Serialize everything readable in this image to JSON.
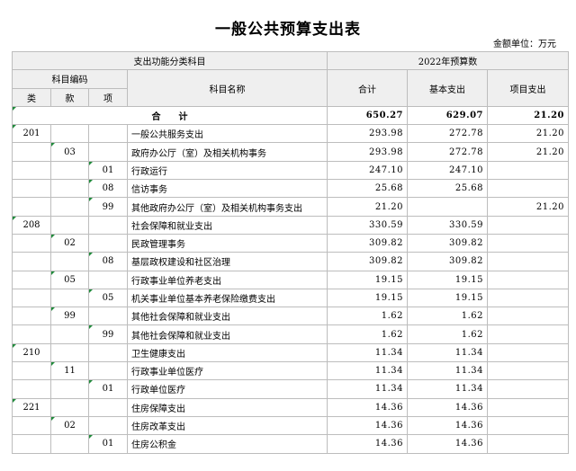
{
  "title": "一般公共预算支出表",
  "unit_label": "金额单位：万元",
  "header": {
    "func_class": "支出功能分类科目",
    "budget_year": "2022年预算数",
    "subject_code": "科目编码",
    "lei": "类",
    "kuan": "款",
    "xiang": "项",
    "subject_name": "科目名称",
    "total": "合计",
    "basic": "基本支出",
    "project": "项目支出"
  },
  "total_row": {
    "label": "合　　计",
    "total": "650.27",
    "basic": "629.07",
    "project": "21.20"
  },
  "rows": [
    {
      "lei": "201",
      "kuan": "",
      "xiang": "",
      "name": "一般公共服务支出",
      "total": "293.98",
      "basic": "272.78",
      "project": "21.20"
    },
    {
      "lei": "",
      "kuan": "03",
      "xiang": "",
      "name": "政府办公厅（室）及相关机构事务",
      "total": "293.98",
      "basic": "272.78",
      "project": "21.20"
    },
    {
      "lei": "",
      "kuan": "",
      "xiang": "01",
      "name": "行政运行",
      "total": "247.10",
      "basic": "247.10",
      "project": ""
    },
    {
      "lei": "",
      "kuan": "",
      "xiang": "08",
      "name": "信访事务",
      "total": "25.68",
      "basic": "25.68",
      "project": ""
    },
    {
      "lei": "",
      "kuan": "",
      "xiang": "99",
      "name": "其他政府办公厅（室）及相关机构事务支出",
      "total": "21.20",
      "basic": "",
      "project": "21.20"
    },
    {
      "lei": "208",
      "kuan": "",
      "xiang": "",
      "name": "社会保障和就业支出",
      "total": "330.59",
      "basic": "330.59",
      "project": ""
    },
    {
      "lei": "",
      "kuan": "02",
      "xiang": "",
      "name": "民政管理事务",
      "total": "309.82",
      "basic": "309.82",
      "project": ""
    },
    {
      "lei": "",
      "kuan": "",
      "xiang": "08",
      "name": "基层政权建设和社区治理",
      "total": "309.82",
      "basic": "309.82",
      "project": ""
    },
    {
      "lei": "",
      "kuan": "05",
      "xiang": "",
      "name": "行政事业单位养老支出",
      "total": "19.15",
      "basic": "19.15",
      "project": ""
    },
    {
      "lei": "",
      "kuan": "",
      "xiang": "05",
      "name": "机关事业单位基本养老保险缴费支出",
      "total": "19.15",
      "basic": "19.15",
      "project": ""
    },
    {
      "lei": "",
      "kuan": "99",
      "xiang": "",
      "name": "其他社会保障和就业支出",
      "total": "1.62",
      "basic": "1.62",
      "project": ""
    },
    {
      "lei": "",
      "kuan": "",
      "xiang": "99",
      "name": "其他社会保障和就业支出",
      "total": "1.62",
      "basic": "1.62",
      "project": ""
    },
    {
      "lei": "210",
      "kuan": "",
      "xiang": "",
      "name": "卫生健康支出",
      "total": "11.34",
      "basic": "11.34",
      "project": ""
    },
    {
      "lei": "",
      "kuan": "11",
      "xiang": "",
      "name": "行政事业单位医疗",
      "total": "11.34",
      "basic": "11.34",
      "project": ""
    },
    {
      "lei": "",
      "kuan": "",
      "xiang": "01",
      "name": "行政单位医疗",
      "total": "11.34",
      "basic": "11.34",
      "project": ""
    },
    {
      "lei": "221",
      "kuan": "",
      "xiang": "",
      "name": "住房保障支出",
      "total": "14.36",
      "basic": "14.36",
      "project": ""
    },
    {
      "lei": "",
      "kuan": "02",
      "xiang": "",
      "name": "住房改革支出",
      "total": "14.36",
      "basic": "14.36",
      "project": ""
    },
    {
      "lei": "",
      "kuan": "",
      "xiang": "01",
      "name": "住房公积金",
      "total": "14.36",
      "basic": "14.36",
      "project": ""
    }
  ]
}
